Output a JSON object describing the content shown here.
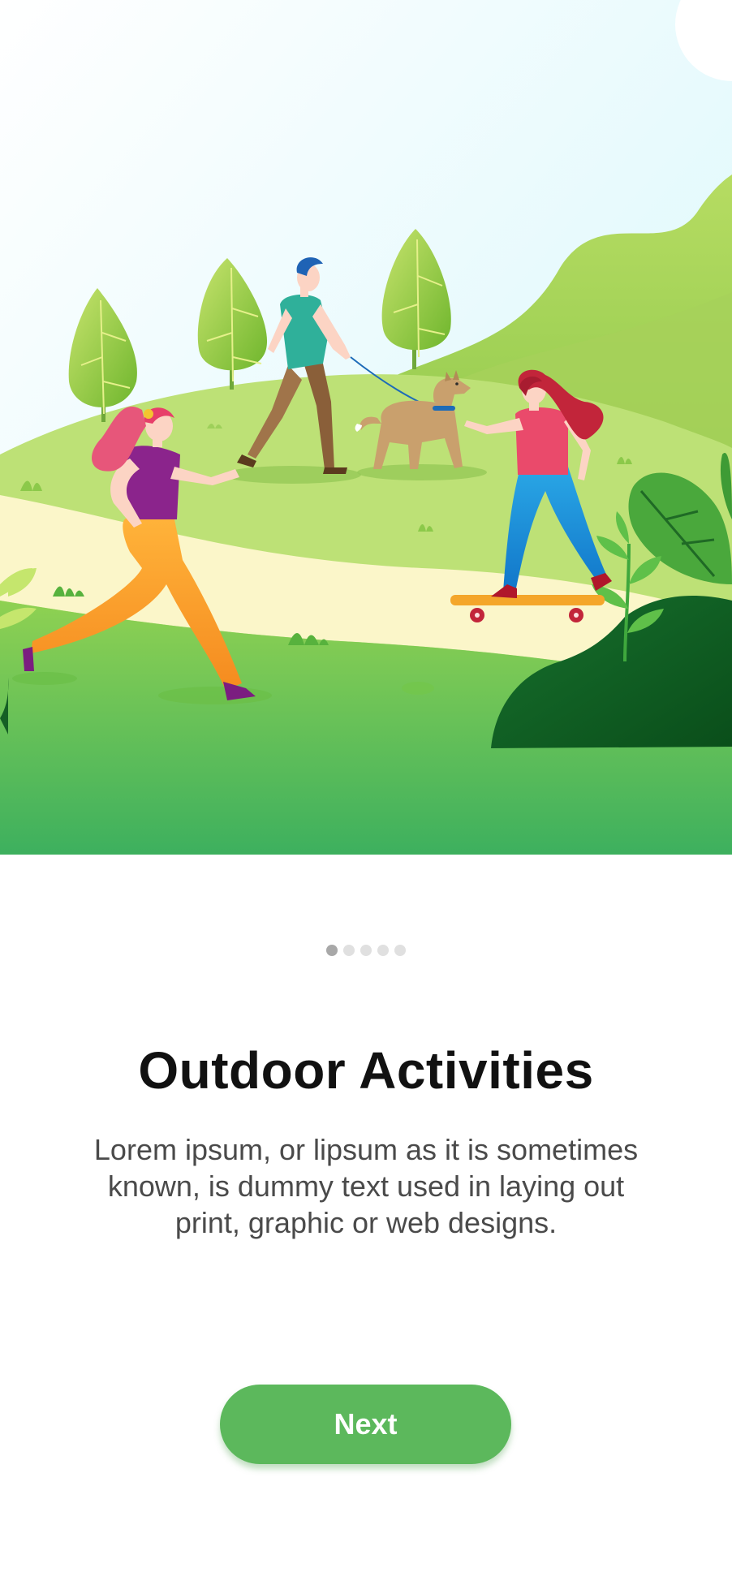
{
  "onboarding": {
    "illustration_label": "park-outdoor-activities",
    "pager": {
      "total": 5,
      "active_index": 0
    },
    "title": "Outdoor Activities",
    "description": "Lorem ipsum, or lipsum as it is sometimes known, is dummy text used in laying out print, graphic or web designs.",
    "next_label": "Next"
  },
  "colors": {
    "primary_green": "#5cb85c",
    "title_text": "#111111",
    "body_text": "#4a4a4a",
    "dot_active": "#a8a8a8",
    "dot_inactive": "#e0e0e0"
  }
}
